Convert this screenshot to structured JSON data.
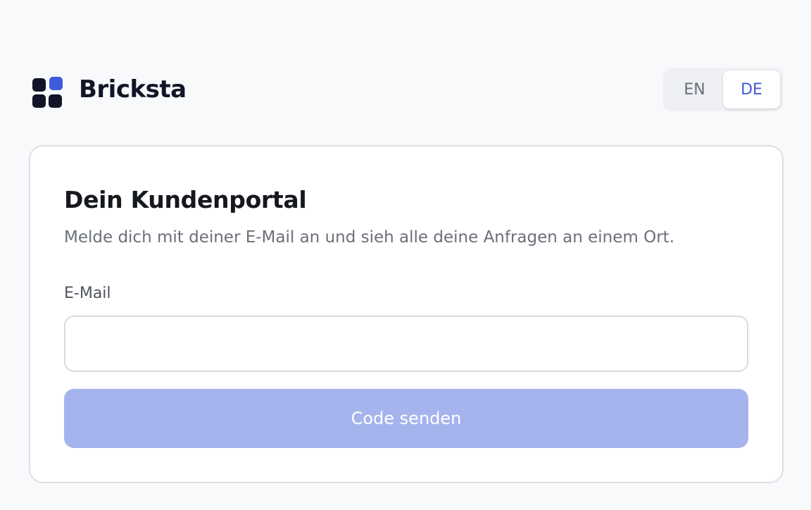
{
  "brand": {
    "name": "Bricksta",
    "logo_icon": "four-square-grid-logo",
    "accent_color": "#3e5bdb"
  },
  "language_switch": {
    "options": [
      "EN",
      "DE"
    ],
    "selected": "DE"
  },
  "login_card": {
    "title": "Dein Kundenportal",
    "subtitle": "Melde dich mit deiner E-Mail an und sieh alle deine Anfragen an einem Ort.",
    "email_label": "E-Mail",
    "email_value": "",
    "email_placeholder": "",
    "submit_label": "Code senden",
    "submit_state": "disabled",
    "submit_color": "#a5b4ed"
  }
}
